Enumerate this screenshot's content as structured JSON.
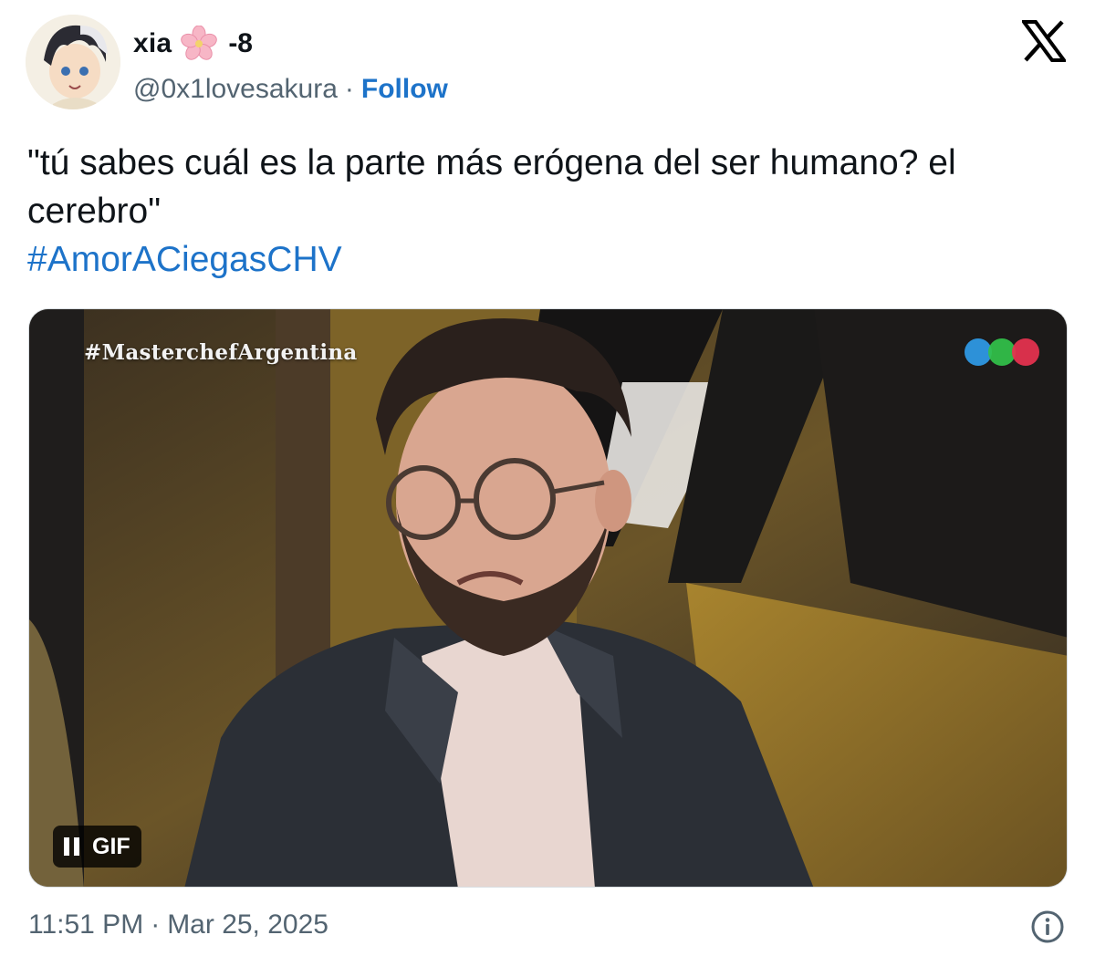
{
  "author": {
    "display_name": "xia",
    "name_suffix": "-8",
    "handle": "@0x1lovesakura",
    "separator": "·",
    "follow_label": "Follow"
  },
  "tweet": {
    "text": "\"tú sabes cuál es la parte más erógena del ser humano? el cerebro\"",
    "hashtag": "#AmorACiegasCHV"
  },
  "media": {
    "watermark": "#MasterchefArgentina",
    "badge_label": "GIF",
    "logo_colors": [
      "#2f9be8",
      "#32c24a",
      "#e8324f"
    ]
  },
  "footer": {
    "time": "11:51 PM",
    "separator": "·",
    "date": "Mar 25, 2025"
  },
  "colors": {
    "link": "#1d73c9",
    "muted": "#536471",
    "text": "#0f1419"
  },
  "icons": [
    "avatar",
    "cherry-blossom-icon",
    "x-logo-icon",
    "pause-icon",
    "info-icon"
  ]
}
